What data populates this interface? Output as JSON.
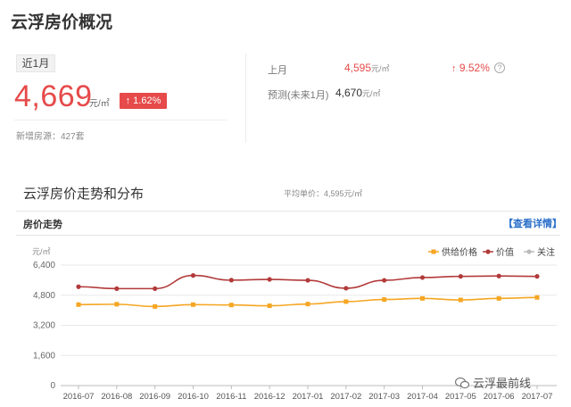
{
  "page": {
    "title": "云浮房价概况"
  },
  "summary": {
    "period_label": "近1月",
    "price": "4,669",
    "price_unit": "元/㎡",
    "change": "1.62%",
    "new_listings": "新增房源：427套"
  },
  "stats": {
    "last_month_label": "上月",
    "last_month_value": "4,595",
    "last_month_unit": "元/㎡",
    "last_month_change": "9.52%",
    "forecast_label": "预测(未来1月)",
    "forecast_value": "4,670",
    "forecast_unit": "元/㎡"
  },
  "trend": {
    "title": "云浮房价走势和分布",
    "avg_price": "平均单价：4,595元/㎡",
    "card_title": "房价走势",
    "details_link": "【查看详情】"
  },
  "watermark": {
    "text": "云浮最前线"
  },
  "colors": {
    "accent_red": "#e64a4a",
    "link_blue": "#2a6fc9",
    "supply": "#f5a623",
    "value": "#b23a3a",
    "attention": "#bbbbbb"
  },
  "chart_data": {
    "type": "line",
    "ylabel": "元/㎡",
    "ylim": [
      0,
      6400
    ],
    "yticks": [
      "0",
      "1,600",
      "3,200",
      "4,800",
      "6,400"
    ],
    "ytick_values": [
      0,
      1600,
      3200,
      4800,
      6400
    ],
    "categories": [
      "2016-07",
      "2016-08",
      "2016-09",
      "2016-10",
      "2016-11",
      "2016-12",
      "2017-01",
      "2017-02",
      "2017-03",
      "2017-04",
      "2017-05",
      "2017-06",
      "2017-07"
    ],
    "legend_position": "top-right",
    "grid": true,
    "series": [
      {
        "name": "供给价格",
        "color": "#f5a623",
        "values": [
          4300,
          4320,
          4200,
          4300,
          4280,
          4240,
          4330,
          4460,
          4570,
          4630,
          4550,
          4630,
          4680
        ]
      },
      {
        "name": "价值",
        "color": "#b23a3a",
        "values": [
          5250,
          5150,
          5150,
          5850,
          5600,
          5640,
          5590,
          5170,
          5590,
          5740,
          5800,
          5820,
          5800
        ]
      },
      {
        "name": "关注",
        "color": "#bbbbbb",
        "values": []
      }
    ]
  }
}
